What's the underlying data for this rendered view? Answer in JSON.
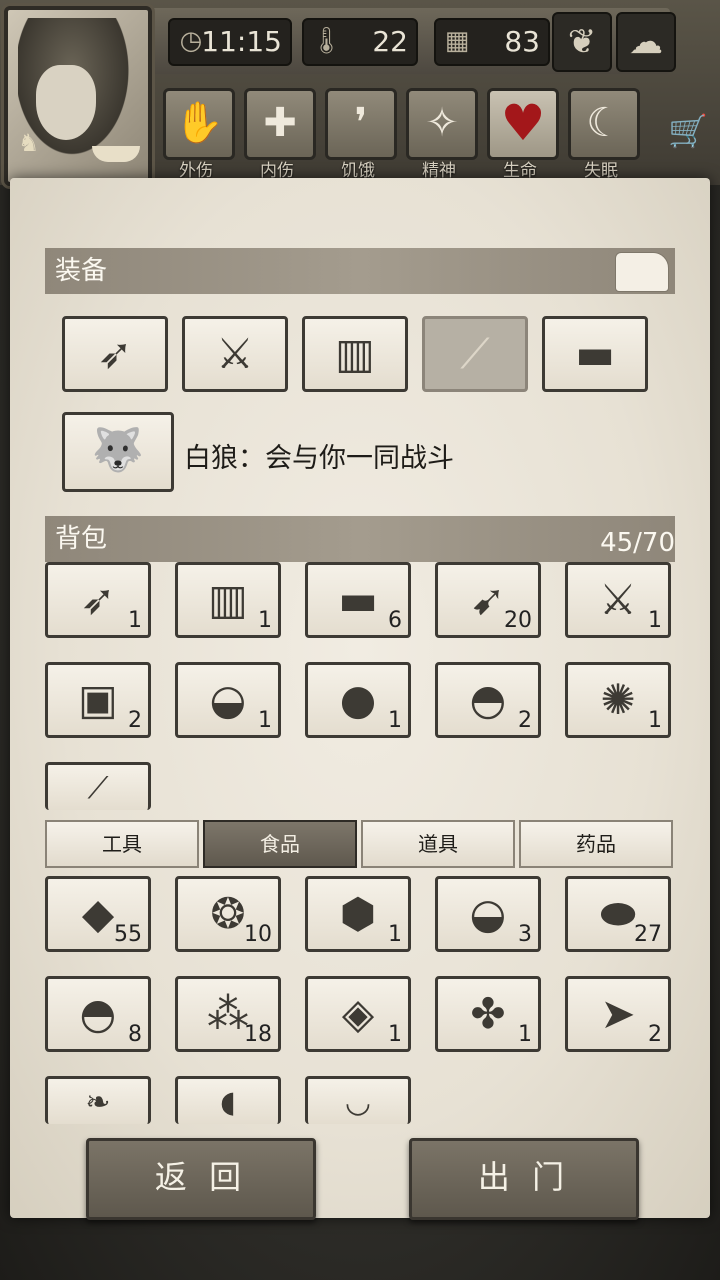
{
  "header": {
    "time": "11:15",
    "temperature": "22",
    "days": "83",
    "time_icon": "clock-icon",
    "temperature_icon": "thermometer-icon",
    "days_icon": "calendar-icon",
    "plant_icon": "sprout-icon",
    "weather_icon": "rain-cloud-icon"
  },
  "status_bar": [
    {
      "label": "外伤",
      "icon": "hand-bandage-icon"
    },
    {
      "label": "内伤",
      "icon": "cross-icon"
    },
    {
      "label": "饥饿",
      "icon": "stomach-icon"
    },
    {
      "label": "精神",
      "icon": "head-stars-icon"
    },
    {
      "label": "生命",
      "icon": "heart-icon",
      "color": "#a3171a"
    },
    {
      "label": "失眠",
      "icon": "moon-icon"
    }
  ],
  "equipment": {
    "title": "装备",
    "slots": [
      {
        "item": "bow"
      },
      {
        "item": "sabre"
      },
      {
        "item": "armor"
      },
      {
        "item": "torch",
        "dimmed": true
      },
      {
        "item": "grenade"
      }
    ],
    "companion": {
      "item": "white-wolf",
      "text": "白狼：会与你一同战斗"
    }
  },
  "backpack": {
    "title": "背包",
    "capacity": "45/70",
    "items": [
      {
        "item": "bow",
        "count": "1"
      },
      {
        "item": "armor",
        "count": "1"
      },
      {
        "item": "grenade",
        "count": "6"
      },
      {
        "item": "arrow",
        "count": "20"
      },
      {
        "item": "sabre",
        "count": "1"
      },
      {
        "item": "sauce-dish",
        "count": "2"
      },
      {
        "item": "stew-bowl",
        "count": "1"
      },
      {
        "item": "bean",
        "count": "1"
      },
      {
        "item": "salad-bowl",
        "count": "2"
      },
      {
        "item": "crab",
        "count": "1"
      },
      {
        "item": "fish-partial",
        "count": ""
      }
    ]
  },
  "tabs": {
    "tools": "工具",
    "food": "食品",
    "props": "道具",
    "medicine": "药品",
    "active": "食品"
  },
  "food_items": [
    {
      "item": "steak",
      "count": "55"
    },
    {
      "item": "onion",
      "count": "10"
    },
    {
      "item": "honeycomb",
      "count": "1"
    },
    {
      "item": "stew-bowl",
      "count": "3"
    },
    {
      "item": "potato",
      "count": "27"
    },
    {
      "item": "salad-bowl",
      "count": "8"
    },
    {
      "item": "berries",
      "count": "18"
    },
    {
      "item": "tropical-fish",
      "count": "1"
    },
    {
      "item": "crayfish",
      "count": "1"
    },
    {
      "item": "fish",
      "count": "2"
    },
    {
      "item": "shrimp",
      "count": ""
    },
    {
      "item": "big-fish",
      "count": ""
    },
    {
      "item": "soup-bowl",
      "count": ""
    }
  ],
  "buttons": {
    "back": "返 回",
    "go_out": "出 门"
  },
  "colors": {
    "paper": "#ebe5d8",
    "section_bar": "#9a9284",
    "active_tab": "#6b6458",
    "heart": "#a3171a"
  }
}
